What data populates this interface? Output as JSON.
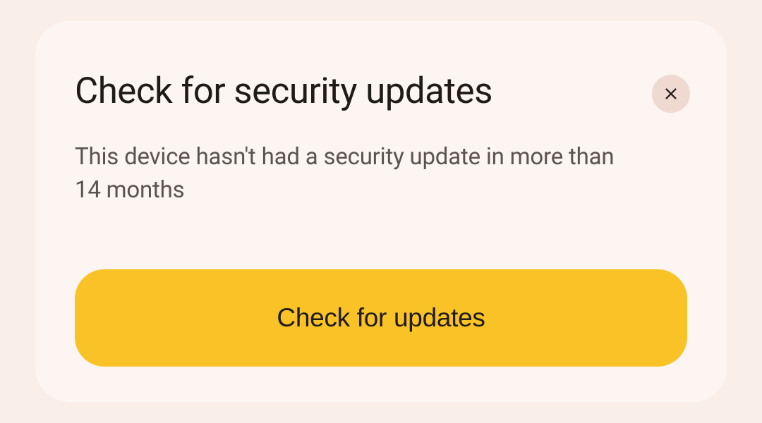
{
  "dialog": {
    "title": "Check for security updates",
    "message": "This device hasn't had a security update in more than 14 months",
    "action_label": "Check for updates"
  }
}
